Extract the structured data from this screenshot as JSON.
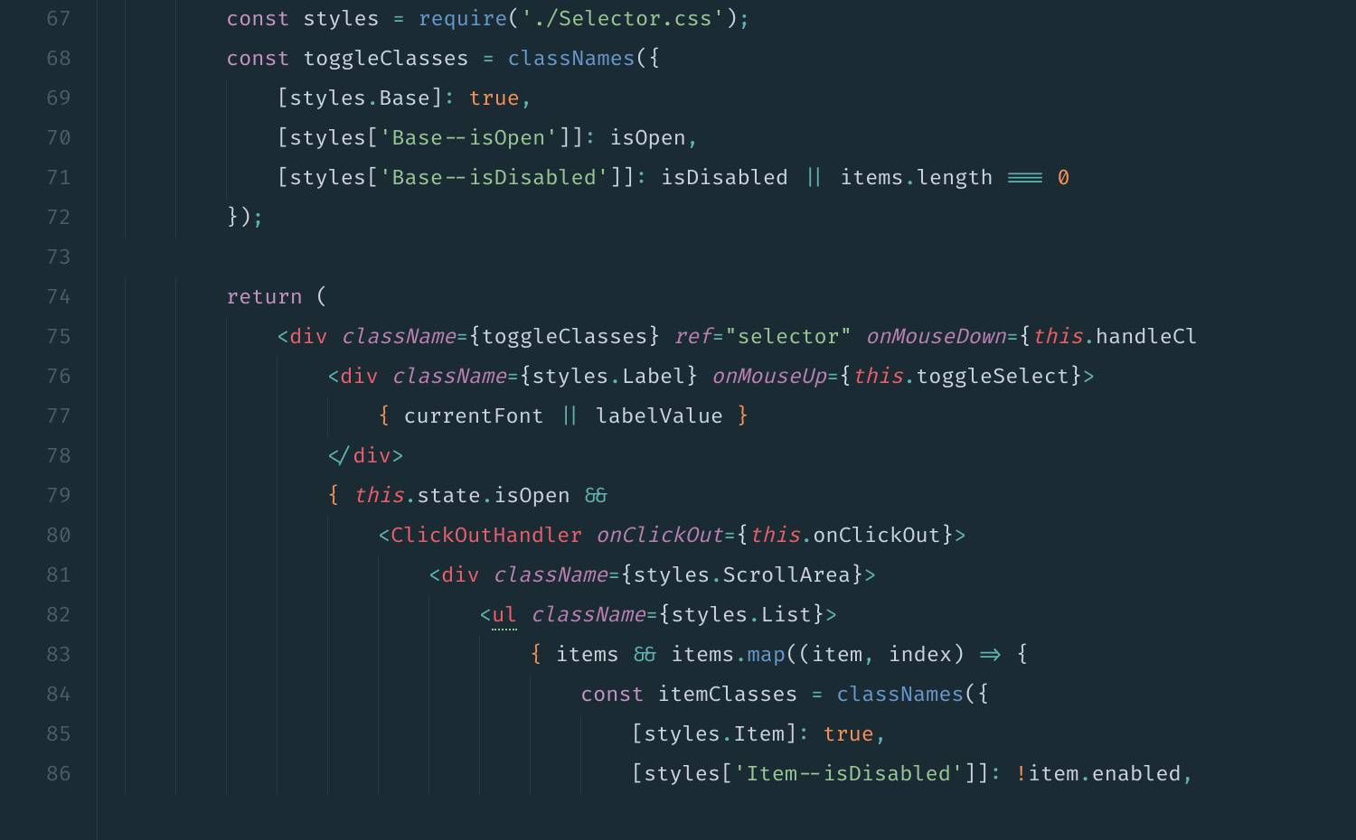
{
  "colors": {
    "background": "#1b2b34",
    "gutter_fg": "#4f5b66",
    "default_fg": "#cdd3de",
    "keyword": "#c594c5",
    "string": "#99c794",
    "number": "#f99157",
    "boolean": "#f99157",
    "function": "#6699cc",
    "punct": "#5fb3b3",
    "tag": "#eb606b",
    "this": "#ec5f67",
    "attr": "#bb80b3"
  },
  "editor": {
    "line_numbers": [
      "67",
      "68",
      "69",
      "70",
      "71",
      "72",
      "73",
      "74",
      "75",
      "76",
      "77",
      "78",
      "79",
      "80",
      "81",
      "82",
      "83",
      "84",
      "85",
      "86"
    ],
    "lines": [
      {
        "indent": 2,
        "tokens": [
          {
            "t": "const ",
            "c": "kw"
          },
          {
            "t": "styles",
            "c": "decl"
          },
          {
            "t": " ",
            "c": "ident"
          },
          {
            "t": "=",
            "c": "op"
          },
          {
            "t": " ",
            "c": "ident"
          },
          {
            "t": "require",
            "c": "fn-call"
          },
          {
            "t": "(",
            "c": "paren"
          },
          {
            "t": "'./Selector.css'",
            "c": "str"
          },
          {
            "t": ")",
            "c": "paren"
          },
          {
            "t": ";",
            "c": "punct"
          }
        ]
      },
      {
        "indent": 2,
        "tokens": [
          {
            "t": "const ",
            "c": "kw"
          },
          {
            "t": "toggleClasses",
            "c": "decl"
          },
          {
            "t": " ",
            "c": "ident"
          },
          {
            "t": "=",
            "c": "op"
          },
          {
            "t": " ",
            "c": "ident"
          },
          {
            "t": "classNames",
            "c": "fn-call"
          },
          {
            "t": "(",
            "c": "paren"
          },
          {
            "t": "{",
            "c": "brace"
          }
        ]
      },
      {
        "indent": 3,
        "tokens": [
          {
            "t": "[",
            "c": "brace"
          },
          {
            "t": "styles",
            "c": "ident"
          },
          {
            "t": ".",
            "c": "punct"
          },
          {
            "t": "Base",
            "c": "ident"
          },
          {
            "t": "]",
            "c": "brace"
          },
          {
            "t": ":",
            "c": "punct"
          },
          {
            "t": " ",
            "c": "ident"
          },
          {
            "t": "true",
            "c": "bool"
          },
          {
            "t": ",",
            "c": "punct"
          }
        ]
      },
      {
        "indent": 3,
        "tokens": [
          {
            "t": "[",
            "c": "brace"
          },
          {
            "t": "styles",
            "c": "ident"
          },
          {
            "t": "[",
            "c": "brace"
          },
          {
            "t": "'Base--isOpen'",
            "c": "str"
          },
          {
            "t": "]",
            "c": "brace"
          },
          {
            "t": "]",
            "c": "brace"
          },
          {
            "t": ":",
            "c": "punct"
          },
          {
            "t": " ",
            "c": "ident"
          },
          {
            "t": "isOpen",
            "c": "ident"
          },
          {
            "t": ",",
            "c": "punct"
          }
        ]
      },
      {
        "indent": 3,
        "tokens": [
          {
            "t": "[",
            "c": "brace"
          },
          {
            "t": "styles",
            "c": "ident"
          },
          {
            "t": "[",
            "c": "brace"
          },
          {
            "t": "'Base--isDisabled'",
            "c": "str"
          },
          {
            "t": "]",
            "c": "brace"
          },
          {
            "t": "]",
            "c": "brace"
          },
          {
            "t": ":",
            "c": "punct"
          },
          {
            "t": " ",
            "c": "ident"
          },
          {
            "t": "isDisabled",
            "c": "ident"
          },
          {
            "t": " ",
            "c": "ident"
          },
          {
            "t": "||",
            "c": "op"
          },
          {
            "t": " ",
            "c": "ident"
          },
          {
            "t": "items",
            "c": "ident"
          },
          {
            "t": ".",
            "c": "punct"
          },
          {
            "t": "length",
            "c": "ident"
          },
          {
            "t": " ",
            "c": "ident"
          },
          {
            "t": "===",
            "c": "op"
          },
          {
            "t": " ",
            "c": "ident"
          },
          {
            "t": "0",
            "c": "num"
          }
        ]
      },
      {
        "indent": 2,
        "tokens": [
          {
            "t": "}",
            "c": "brace"
          },
          {
            "t": ")",
            "c": "paren"
          },
          {
            "t": ";",
            "c": "punct"
          }
        ]
      },
      {
        "indent": 0,
        "tokens": []
      },
      {
        "indent": 2,
        "tokens": [
          {
            "t": "return",
            "c": "kw"
          },
          {
            "t": " ",
            "c": "ident"
          },
          {
            "t": "(",
            "c": "paren"
          }
        ]
      },
      {
        "indent": 3,
        "tokens": [
          {
            "t": "<",
            "c": "tag-ang"
          },
          {
            "t": "div",
            "c": "tag-name"
          },
          {
            "t": " ",
            "c": "ident"
          },
          {
            "t": "className",
            "c": "attr"
          },
          {
            "t": "=",
            "c": "op"
          },
          {
            "t": "{",
            "c": "jsx-brace"
          },
          {
            "t": "toggleClasses",
            "c": "ident"
          },
          {
            "t": "}",
            "c": "jsx-brace"
          },
          {
            "t": " ",
            "c": "ident"
          },
          {
            "t": "ref",
            "c": "attr"
          },
          {
            "t": "=",
            "c": "op"
          },
          {
            "t": "\"selector\"",
            "c": "str"
          },
          {
            "t": " ",
            "c": "ident"
          },
          {
            "t": "onMouseDown",
            "c": "attr"
          },
          {
            "t": "=",
            "c": "op"
          },
          {
            "t": "{",
            "c": "jsx-brace"
          },
          {
            "t": "this",
            "c": "this"
          },
          {
            "t": ".",
            "c": "punct"
          },
          {
            "t": "handleCl",
            "c": "ident"
          }
        ]
      },
      {
        "indent": 4,
        "tokens": [
          {
            "t": "<",
            "c": "tag-ang"
          },
          {
            "t": "div",
            "c": "tag-name"
          },
          {
            "t": " ",
            "c": "ident"
          },
          {
            "t": "className",
            "c": "attr"
          },
          {
            "t": "=",
            "c": "op"
          },
          {
            "t": "{",
            "c": "jsx-brace"
          },
          {
            "t": "styles",
            "c": "ident"
          },
          {
            "t": ".",
            "c": "punct"
          },
          {
            "t": "Label",
            "c": "ident"
          },
          {
            "t": "}",
            "c": "jsx-brace"
          },
          {
            "t": " ",
            "c": "ident"
          },
          {
            "t": "onMouseUp",
            "c": "attr"
          },
          {
            "t": "=",
            "c": "op"
          },
          {
            "t": "{",
            "c": "jsx-brace"
          },
          {
            "t": "this",
            "c": "this"
          },
          {
            "t": ".",
            "c": "punct"
          },
          {
            "t": "toggleSelect",
            "c": "ident"
          },
          {
            "t": "}",
            "c": "jsx-brace"
          },
          {
            "t": ">",
            "c": "tag-ang"
          }
        ]
      },
      {
        "indent": 5,
        "tokens": [
          {
            "t": "{",
            "c": "jsx-expr-brace"
          },
          {
            "t": " ",
            "c": "ident"
          },
          {
            "t": "currentFont",
            "c": "ident"
          },
          {
            "t": " ",
            "c": "ident"
          },
          {
            "t": "||",
            "c": "op"
          },
          {
            "t": " ",
            "c": "ident"
          },
          {
            "t": "labelValue",
            "c": "ident"
          },
          {
            "t": " ",
            "c": "ident"
          },
          {
            "t": "}",
            "c": "jsx-expr-brace"
          }
        ]
      },
      {
        "indent": 4,
        "tokens": [
          {
            "t": "</",
            "c": "tag-ang"
          },
          {
            "t": "div",
            "c": "tag-name"
          },
          {
            "t": ">",
            "c": "tag-ang"
          }
        ]
      },
      {
        "indent": 4,
        "tokens": [
          {
            "t": "{",
            "c": "jsx-expr-brace"
          },
          {
            "t": " ",
            "c": "ident"
          },
          {
            "t": "this",
            "c": "this"
          },
          {
            "t": ".",
            "c": "punct"
          },
          {
            "t": "state",
            "c": "ident"
          },
          {
            "t": ".",
            "c": "punct"
          },
          {
            "t": "isOpen",
            "c": "ident"
          },
          {
            "t": " ",
            "c": "ident"
          },
          {
            "t": "&&",
            "c": "op"
          }
        ]
      },
      {
        "indent": 5,
        "tokens": [
          {
            "t": "<",
            "c": "tag-ang"
          },
          {
            "t": "ClickOutHandler",
            "c": "tag-name"
          },
          {
            "t": " ",
            "c": "ident"
          },
          {
            "t": "onClickOut",
            "c": "attr"
          },
          {
            "t": "=",
            "c": "op"
          },
          {
            "t": "{",
            "c": "jsx-brace"
          },
          {
            "t": "this",
            "c": "this"
          },
          {
            "t": ".",
            "c": "punct"
          },
          {
            "t": "onClickOut",
            "c": "ident"
          },
          {
            "t": "}",
            "c": "jsx-brace"
          },
          {
            "t": ">",
            "c": "tag-ang"
          }
        ]
      },
      {
        "indent": 6,
        "tokens": [
          {
            "t": "<",
            "c": "tag-ang"
          },
          {
            "t": "div",
            "c": "tag-name"
          },
          {
            "t": " ",
            "c": "ident"
          },
          {
            "t": "className",
            "c": "attr"
          },
          {
            "t": "=",
            "c": "op"
          },
          {
            "t": "{",
            "c": "jsx-brace"
          },
          {
            "t": "styles",
            "c": "ident"
          },
          {
            "t": ".",
            "c": "punct"
          },
          {
            "t": "ScrollArea",
            "c": "ident"
          },
          {
            "t": "}",
            "c": "jsx-brace"
          },
          {
            "t": ">",
            "c": "tag-ang"
          }
        ]
      },
      {
        "indent": 7,
        "tokens": [
          {
            "t": "<",
            "c": "tag-ang"
          },
          {
            "t": "ul",
            "c": "tag-name underline-green"
          },
          {
            "t": " ",
            "c": "ident"
          },
          {
            "t": "className",
            "c": "attr"
          },
          {
            "t": "=",
            "c": "op"
          },
          {
            "t": "{",
            "c": "jsx-brace"
          },
          {
            "t": "styles",
            "c": "ident"
          },
          {
            "t": ".",
            "c": "punct"
          },
          {
            "t": "List",
            "c": "ident"
          },
          {
            "t": "}",
            "c": "jsx-brace"
          },
          {
            "t": ">",
            "c": "tag-ang"
          }
        ]
      },
      {
        "indent": 8,
        "tokens": [
          {
            "t": "{",
            "c": "jsx-expr-brace"
          },
          {
            "t": " ",
            "c": "ident"
          },
          {
            "t": "items",
            "c": "ident"
          },
          {
            "t": " ",
            "c": "ident"
          },
          {
            "t": "&&",
            "c": "op"
          },
          {
            "t": " ",
            "c": "ident"
          },
          {
            "t": "items",
            "c": "ident"
          },
          {
            "t": ".",
            "c": "punct"
          },
          {
            "t": "map",
            "c": "fn-call"
          },
          {
            "t": "(",
            "c": "paren"
          },
          {
            "t": "(",
            "c": "paren"
          },
          {
            "t": "item",
            "c": "ident"
          },
          {
            "t": ",",
            "c": "punct"
          },
          {
            "t": " ",
            "c": "ident"
          },
          {
            "t": "index",
            "c": "ident"
          },
          {
            "t": ")",
            "c": "paren"
          },
          {
            "t": " ",
            "c": "ident"
          },
          {
            "t": "=>",
            "c": "op"
          },
          {
            "t": " ",
            "c": "ident"
          },
          {
            "t": "{",
            "c": "brace"
          }
        ]
      },
      {
        "indent": 9,
        "tokens": [
          {
            "t": "const ",
            "c": "kw"
          },
          {
            "t": "itemClasses",
            "c": "decl"
          },
          {
            "t": " ",
            "c": "ident"
          },
          {
            "t": "=",
            "c": "op"
          },
          {
            "t": " ",
            "c": "ident"
          },
          {
            "t": "classNames",
            "c": "fn-call"
          },
          {
            "t": "(",
            "c": "paren"
          },
          {
            "t": "{",
            "c": "brace"
          }
        ]
      },
      {
        "indent": 10,
        "tokens": [
          {
            "t": "[",
            "c": "brace"
          },
          {
            "t": "styles",
            "c": "ident"
          },
          {
            "t": ".",
            "c": "punct"
          },
          {
            "t": "Item",
            "c": "ident"
          },
          {
            "t": "]",
            "c": "brace"
          },
          {
            "t": ":",
            "c": "punct"
          },
          {
            "t": " ",
            "c": "ident"
          },
          {
            "t": "true",
            "c": "bool"
          },
          {
            "t": ",",
            "c": "punct"
          }
        ]
      },
      {
        "indent": 10,
        "tokens": [
          {
            "t": "[",
            "c": "brace"
          },
          {
            "t": "styles",
            "c": "ident"
          },
          {
            "t": "[",
            "c": "brace"
          },
          {
            "t": "'Item--isDisabled'",
            "c": "str"
          },
          {
            "t": "]",
            "c": "brace"
          },
          {
            "t": "]",
            "c": "brace"
          },
          {
            "t": ":",
            "c": "punct"
          },
          {
            "t": " ",
            "c": "ident"
          },
          {
            "t": "!",
            "c": "bool"
          },
          {
            "t": "item",
            "c": "ident"
          },
          {
            "t": ".",
            "c": "punct"
          },
          {
            "t": "enabled",
            "c": "ident"
          },
          {
            "t": ",",
            "c": "punct"
          }
        ]
      }
    ]
  }
}
